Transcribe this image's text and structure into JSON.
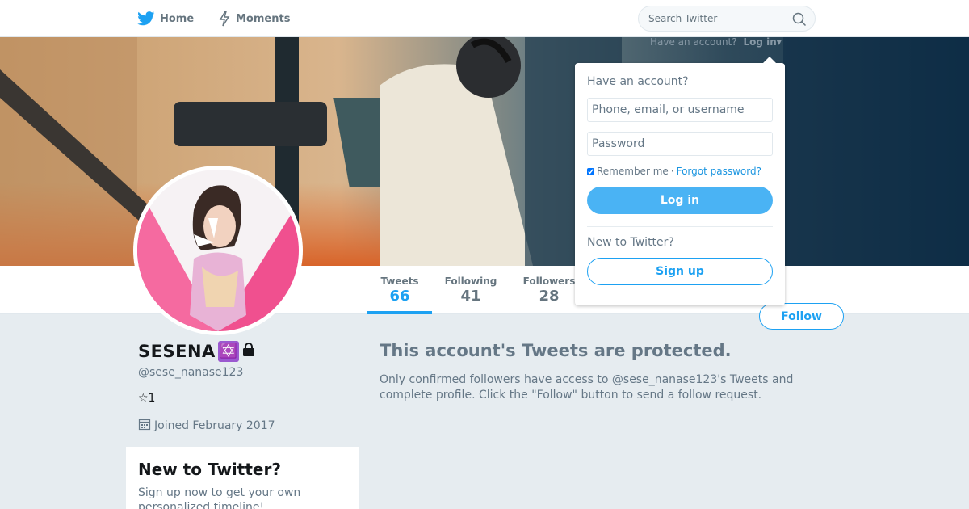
{
  "nav": {
    "home_label": "Home",
    "moments_label": "Moments",
    "search_placeholder": "Search Twitter"
  },
  "account_prompt": {
    "text": "Have an account?",
    "login_label": "Log in"
  },
  "profile": {
    "name": "SESENA",
    "name_emoji": "✡️",
    "lock_icon": "lock-icon",
    "handle": "@sese_nanase123",
    "bio": "☆1",
    "joined": "Joined February 2017"
  },
  "stats": [
    {
      "label": "Tweets",
      "value": "66"
    },
    {
      "label": "Following",
      "value": "41"
    },
    {
      "label": "Followers",
      "value": "28"
    }
  ],
  "follow_label": "Follow",
  "protected": {
    "title": "This account's Tweets are protected.",
    "text": "Only confirmed followers have access to @sese_nanase123's Tweets and complete profile. Click the \"Follow\" button to send a follow request."
  },
  "signup_card": {
    "title": "New to Twitter?",
    "text": "Sign up now to get your own personalized timeline!"
  },
  "login_dropdown": {
    "title": "Have an account?",
    "username_placeholder": "Phone, email, or username",
    "password_placeholder": "Password",
    "remember_label": "Remember me",
    "separator": "·",
    "forgot_label": "Forgot password?",
    "login_button": "Log in",
    "new_title": "New to Twitter?",
    "signup_button": "Sign up"
  },
  "colors": {
    "accent": "#1da1f2",
    "background": "#e6ecf0",
    "avatar_pink": "#f0508f"
  }
}
